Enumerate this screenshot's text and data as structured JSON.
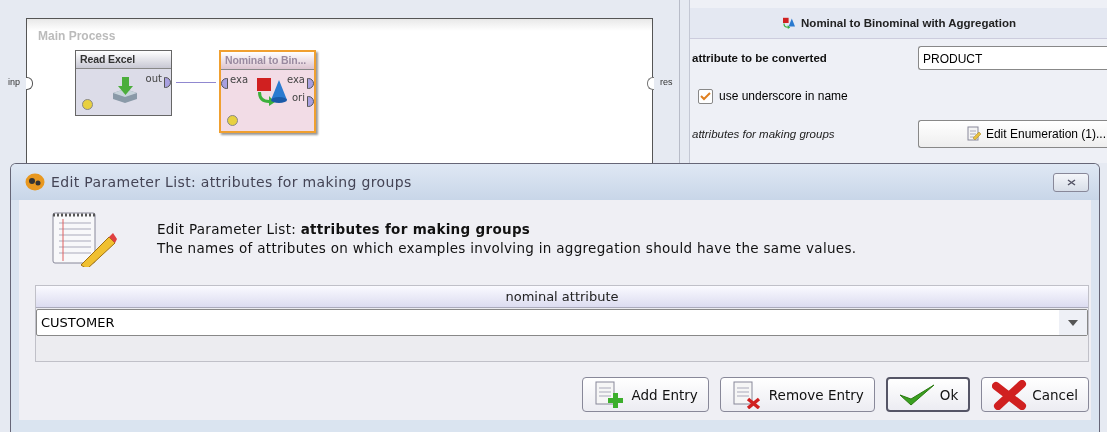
{
  "process": {
    "title": "Main Process",
    "input_port": "inp",
    "result_port": "res",
    "operators": [
      {
        "name": "Read Excel",
        "selected": false,
        "kind": "read",
        "outputs": [
          "out"
        ]
      },
      {
        "name": "Nominal to Bin...",
        "selected": true,
        "kind": "convert",
        "inputs": [
          "exa"
        ],
        "outputs": [
          "exa",
          "ori"
        ]
      }
    ]
  },
  "parameters": {
    "title": "Nominal to Binominal with Aggregation",
    "rows": [
      {
        "kind": "field",
        "label": "attribute to be converted",
        "value": "PRODUCT"
      },
      {
        "kind": "checkbox",
        "label": "use underscore in name",
        "checked": true
      },
      {
        "kind": "button",
        "label": "attributes for making groups",
        "button": "Edit Enumeration (1)..."
      }
    ]
  },
  "dialog": {
    "title": "Edit Parameter List: attributes for making groups",
    "heading": "Edit Parameter List: **attributes for making groups**",
    "description": "The names of attributes on which examples involving in aggregation should have the same values.",
    "table": {
      "columns": [
        "nominal attribute"
      ],
      "rows": [
        {
          "value": "CUSTOMER"
        }
      ]
    },
    "buttons": [
      {
        "label": "Add Entry",
        "kind": "add",
        "default": false
      },
      {
        "label": "Remove Entry",
        "kind": "remove",
        "default": false
      },
      {
        "label": "Ok",
        "kind": "ok",
        "default": true
      },
      {
        "label": "Cancel",
        "kind": "cancel",
        "default": false
      }
    ]
  }
}
